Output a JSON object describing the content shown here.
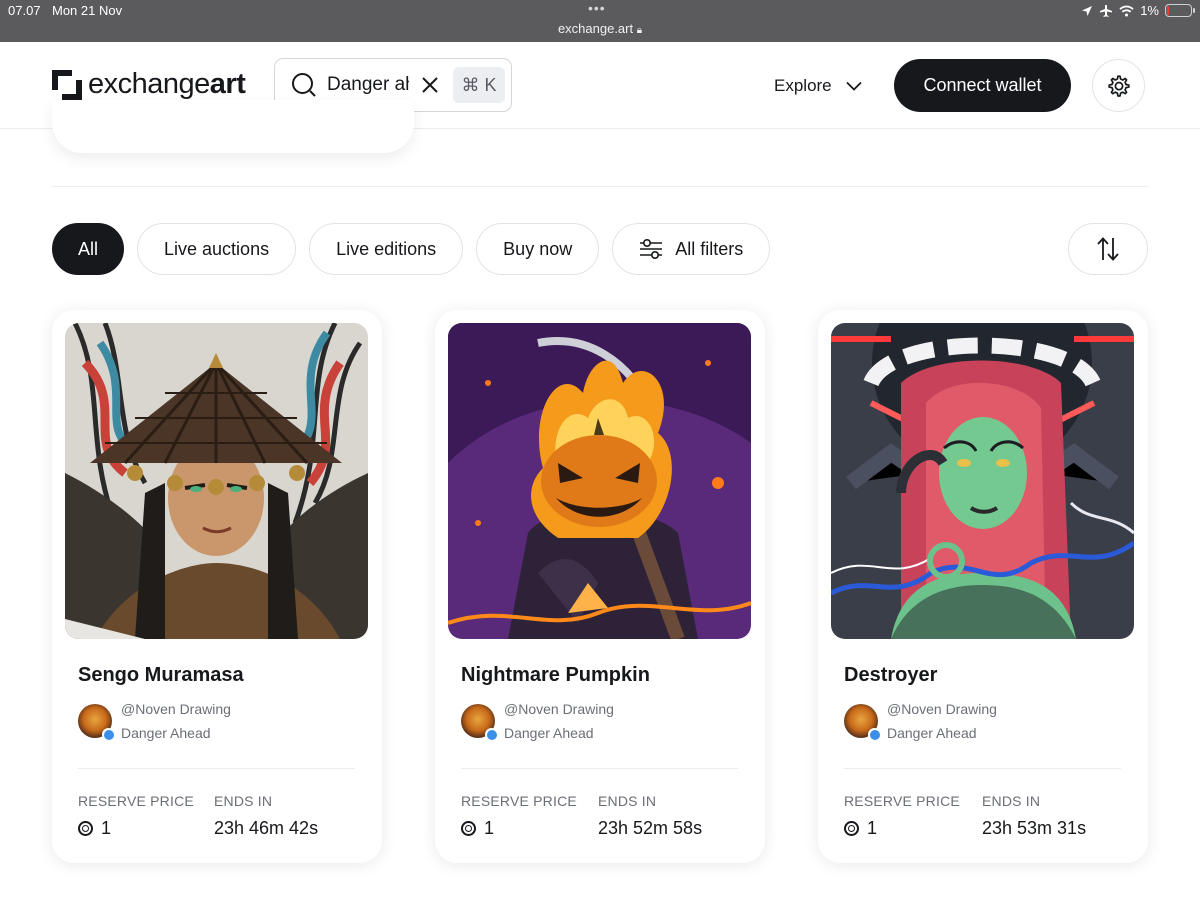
{
  "status_bar": {
    "time": "07.07",
    "date": "Mon 21 Nov",
    "url": "exchange.art",
    "battery": "1%"
  },
  "header": {
    "logo_regular": "exchange",
    "logo_bold": "art",
    "search_value": "Danger ah",
    "search_shortcut": "⌘ K",
    "explore_label": "Explore",
    "connect_label": "Connect wallet"
  },
  "filters": {
    "pills": [
      "All",
      "Live auctions",
      "Live editions",
      "Buy now",
      "All filters"
    ],
    "active": "All"
  },
  "cards": [
    {
      "title": "Sengo Muramasa",
      "creator": "@Noven Drawing",
      "collection": "Danger Ahead",
      "reserve_label": "RESERVE PRICE",
      "reserve_value": "1",
      "ends_label": "ENDS IN",
      "ends_value": "23h 46m 42s"
    },
    {
      "title": "Nightmare Pumpkin",
      "creator": "@Noven Drawing",
      "collection": "Danger Ahead",
      "reserve_label": "RESERVE PRICE",
      "reserve_value": "1",
      "ends_label": "ENDS IN",
      "ends_value": "23h 52m 58s"
    },
    {
      "title": "Destroyer",
      "creator": "@Noven Drawing",
      "collection": "Danger Ahead",
      "reserve_label": "RESERVE PRICE",
      "reserve_value": "1",
      "ends_label": "ENDS IN",
      "ends_value": "23h 53m 31s"
    }
  ],
  "colors": {
    "primary_dark": "#16181c",
    "muted_text": "#6b6e76",
    "border": "#e2e3e6",
    "verified_blue": "#3b8fe8"
  }
}
